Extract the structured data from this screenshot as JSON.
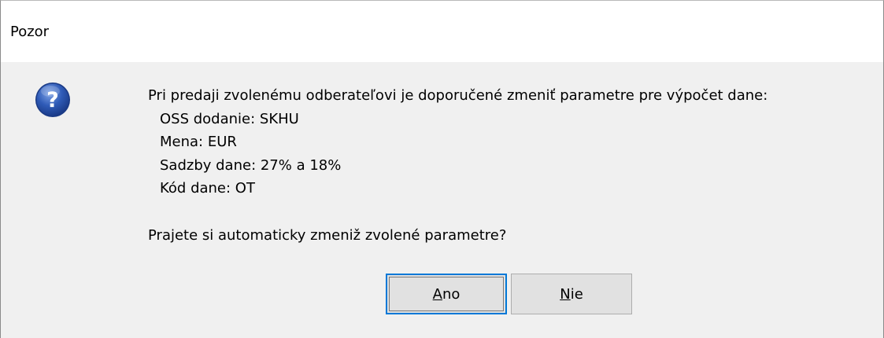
{
  "dialog": {
    "title": "Pozor",
    "icon": "question-icon",
    "message": {
      "intro": "Pri predaji zvolenému odberateľovi je doporučené zmeniť parametre pre výpočet dane:",
      "lines": [
        "OSS dodanie: SKHU",
        "Mena: EUR",
        "Sadzby dane: 27% a 18%",
        "Kód dane: OT"
      ],
      "question": "Prajete si automaticky zmeniž zvolené parametre?"
    },
    "buttons": {
      "yes": {
        "mnemonic": "A",
        "rest": "no"
      },
      "no": {
        "mnemonic": "N",
        "rest": "ie"
      }
    }
  },
  "colors": {
    "titlebar": "#ffffff",
    "body": "#f0f0f0",
    "button": "#e1e1e1",
    "focus_border": "#0078d7",
    "icon_blue": "#2f5bb7"
  }
}
